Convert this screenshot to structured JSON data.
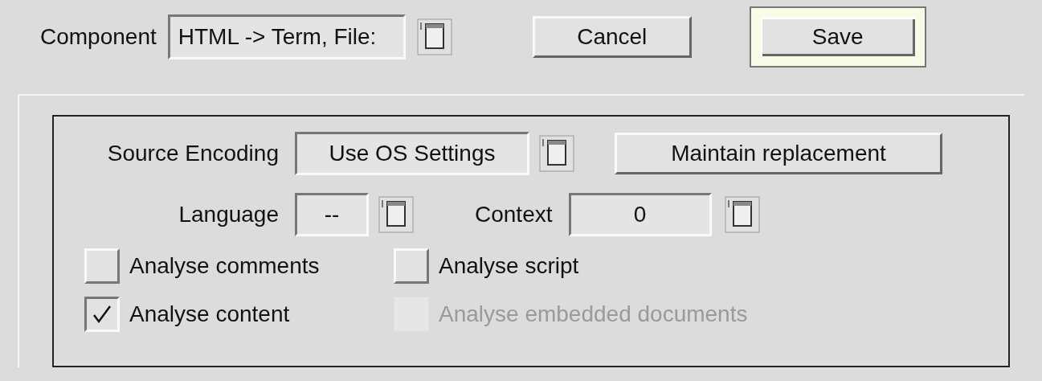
{
  "component": {
    "label": "Component",
    "value": "HTML -> Term, File:"
  },
  "buttons": [
    {
      "label": "Cancel",
      "default": false
    },
    {
      "label": "Save",
      "default": true
    }
  ],
  "encoding": {
    "label": "Source Encoding",
    "value": "Use OS Settings",
    "button": "Maintain replacement"
  },
  "language": {
    "label": "Language",
    "value": "--"
  },
  "context": {
    "label": "Context",
    "value": "0"
  },
  "checkboxes": [
    {
      "label": "Analyse comments",
      "checked": false,
      "disabled": false
    },
    {
      "label": "Analyse script",
      "checked": false,
      "disabled": false
    },
    {
      "label": "Analyse content",
      "checked": true,
      "disabled": false
    },
    {
      "label": "Analyse embedded documents",
      "checked": false,
      "disabled": true
    }
  ]
}
